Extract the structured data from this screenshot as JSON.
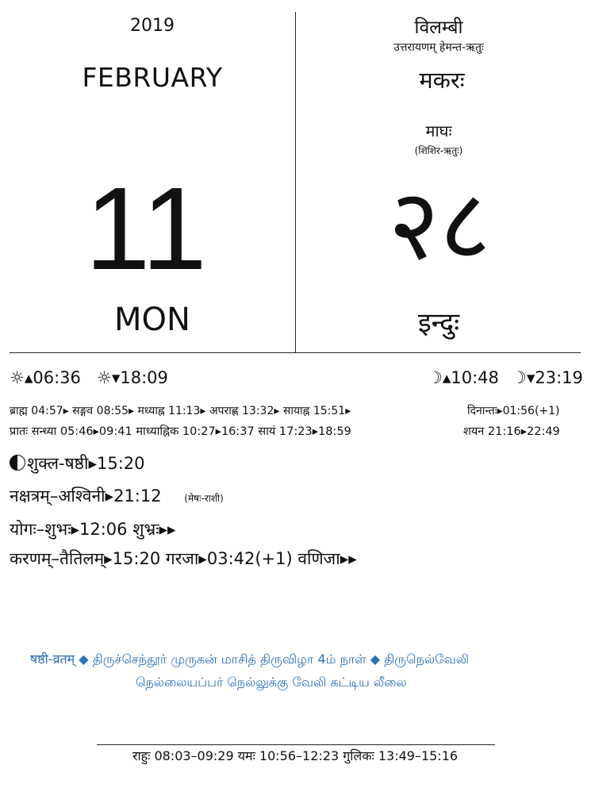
{
  "left": {
    "year": "2019",
    "month": "FEBRUARY",
    "day": "11",
    "weekday": "MON"
  },
  "right": {
    "samvatsara": "विलम्बी",
    "ayana_ritu": "उत्तरायणम्   हेमन्त-ऋतुः",
    "solar_month": "मकरः",
    "lunar_month": "माघः",
    "lunar_ritu": "(शिशिर-ऋतुः)",
    "solar_day": "२८",
    "vara": "इन्दुः"
  },
  "sun_moon": {
    "sunrise": "☼▴06:36",
    "sunset": "☼▾18:09",
    "moonrise": "☽▴10:48",
    "moonset": "☽▾23:19"
  },
  "times": {
    "row1": "ब्राह्म 04:57▸ सङ्गव 08:55▸ मध्याह्न 11:13▸ अपराह्ण 13:32▸ सायाह्न 15:51▸",
    "row1_right": "दिनान्तः▸01:56(+1)",
    "row2": "प्रातः सन्ध्या 05:46▸09:41 माध्याह्निक 10:27▸16:37 सायं 17:23▸18:59",
    "row2_right": "शयन 21:16▸22:49"
  },
  "panchanga": {
    "tithi": "शुक्ल-षष्ठी▸15:20",
    "nakshatra": "नक्षत्रम्–अश्विनी▸21:12",
    "rashi": "(मेषः-राशी)",
    "yoga": "योगः–शुभः▸12:06  शुभ्रः▸▸",
    "karana": "करणम्–तैतिलम्▸15:20  गरजा▸03:42(+1)  वणिजा▸▸"
  },
  "festivals": {
    "line1": "षष्ठी-व्रतम्  ◆  திருச்செந்தூர் முருகன் மாசித் திருவிழா 4ம் நாள்  ◆  திருநெல்வேலி",
    "line2": "நெல்லையப்பர் நெல்லுக்கு வேலி கட்டிய லீலை"
  },
  "footer": {
    "text": "राहुः  08:03–09:29   यमः  10:56–12:23   गुलिकः  13:49–15:16"
  },
  "colors": {
    "festival": "#2a6fb8",
    "text": "#111111"
  },
  "icons": [
    "sun-rise-icon",
    "sun-set-icon",
    "moon-rise-icon",
    "moon-set-icon",
    "half-moon-icon"
  ]
}
